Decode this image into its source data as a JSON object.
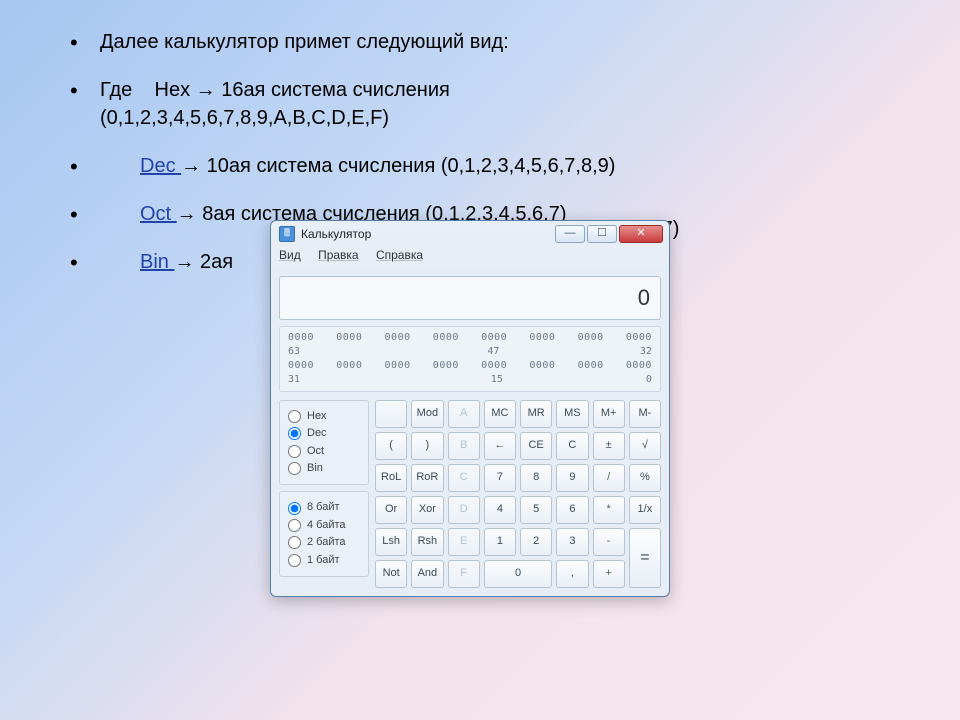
{
  "bullets": {
    "b1": "Далее калькулятор примет следующий вид:",
    "b2a": "Где    Hex → 16ая система счисления",
    "b2b": "(0,1,2,3,4,5,6,7,8,9,A,B,C,D,E,F)",
    "b3link": "Dec ",
    "b3rest": "→ 10ая система счисления  (0,1,2,3,4,5,6,7,8,9)",
    "b4link": "Oct ",
    "b4rest": "→ 8ая система счисления   (0,1,2,3,4,5,6,7)",
    "b5link": "Bin ",
    "b5rest": "→ 2ая"
  },
  "behind_text": "6,7)",
  "calc": {
    "title": "Калькулятор",
    "menu": {
      "view": "Вид",
      "edit": "Правка",
      "help": "Справка"
    },
    "display": "0",
    "bits": {
      "row1": [
        "0000",
        "0000",
        "0000",
        "0000",
        "0000",
        "0000",
        "0000",
        "0000"
      ],
      "mark1": [
        "63",
        "",
        "",
        "",
        "47",
        "",
        "",
        "32"
      ],
      "row2": [
        "0000",
        "0000",
        "0000",
        "0000",
        "0000",
        "0000",
        "0000",
        "0000"
      ],
      "mark2": [
        "31",
        "",
        "",
        "",
        "15",
        "",
        "",
        "0"
      ]
    },
    "radios_base": [
      {
        "label": "Hex",
        "checked": false
      },
      {
        "label": "Dec",
        "checked": true
      },
      {
        "label": "Oct",
        "checked": false
      },
      {
        "label": "Bin",
        "checked": false
      }
    ],
    "radios_word": [
      {
        "label": "8 байт",
        "checked": true
      },
      {
        "label": "4 байта",
        "checked": false
      },
      {
        "label": "2 байта",
        "checked": false
      },
      {
        "label": "1 байт",
        "checked": false
      }
    ],
    "buttons": {
      "r1": [
        "",
        "Mod",
        "A",
        "MC",
        "MR",
        "MS",
        "M+",
        "M-"
      ],
      "r2": [
        "(",
        ")",
        "B",
        "←",
        "CE",
        "C",
        "±",
        "√"
      ],
      "r3": [
        "RoL",
        "RoR",
        "C",
        "7",
        "8",
        "9",
        "/",
        "%"
      ],
      "r4": [
        "Or",
        "Xor",
        "D",
        "4",
        "5",
        "6",
        "*",
        "1/x"
      ],
      "r5": [
        "Lsh",
        "Rsh",
        "E",
        "1",
        "2",
        "3",
        "-",
        "="
      ],
      "r6": [
        "Not",
        "And",
        "F",
        "0",
        "0",
        ",",
        "+",
        "="
      ]
    }
  }
}
